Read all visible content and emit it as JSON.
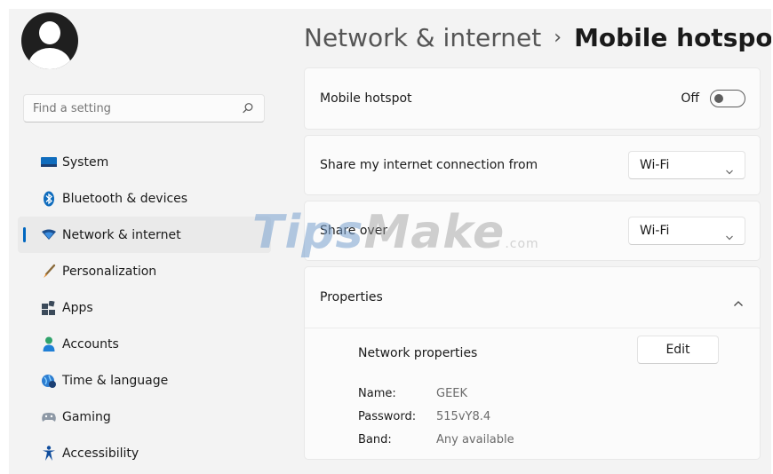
{
  "search": {
    "placeholder": "Find a setting"
  },
  "sidebar": {
    "items": [
      {
        "label": "System",
        "icon": "monitor-icon",
        "active": false
      },
      {
        "label": "Bluetooth & devices",
        "icon": "bluetooth-icon",
        "active": false
      },
      {
        "label": "Network & internet",
        "icon": "wifi-icon",
        "active": true
      },
      {
        "label": "Personalization",
        "icon": "brush-icon",
        "active": false
      },
      {
        "label": "Apps",
        "icon": "apps-icon",
        "active": false
      },
      {
        "label": "Accounts",
        "icon": "person-icon",
        "active": false
      },
      {
        "label": "Time & language",
        "icon": "globe-clock-icon",
        "active": false
      },
      {
        "label": "Gaming",
        "icon": "gamepad-icon",
        "active": false
      },
      {
        "label": "Accessibility",
        "icon": "accessibility-icon",
        "active": false
      }
    ]
  },
  "breadcrumb": {
    "parent": "Network & internet",
    "separator": "›",
    "current": "Mobile hotspot"
  },
  "hotspot": {
    "label": "Mobile hotspot",
    "state": "Off"
  },
  "share_from": {
    "label": "Share my internet connection from",
    "value": "Wi-Fi"
  },
  "share_over": {
    "label": "Share over",
    "value": "Wi-Fi"
  },
  "properties": {
    "label": "Properties",
    "network_properties_label": "Network properties",
    "edit_label": "Edit",
    "name_key": "Name:",
    "name_value": "GEEK",
    "password_key": "Password:",
    "password_value": "515vY8.4",
    "band_key": "Band:",
    "band_value": "Any available"
  },
  "watermark": {
    "brand_a": "Tips",
    "brand_b": "Make",
    "suffix": ".com"
  },
  "colors": {
    "accent": "#0067c0",
    "background": "#f3f3f3",
    "card": "#fbfbfb"
  }
}
